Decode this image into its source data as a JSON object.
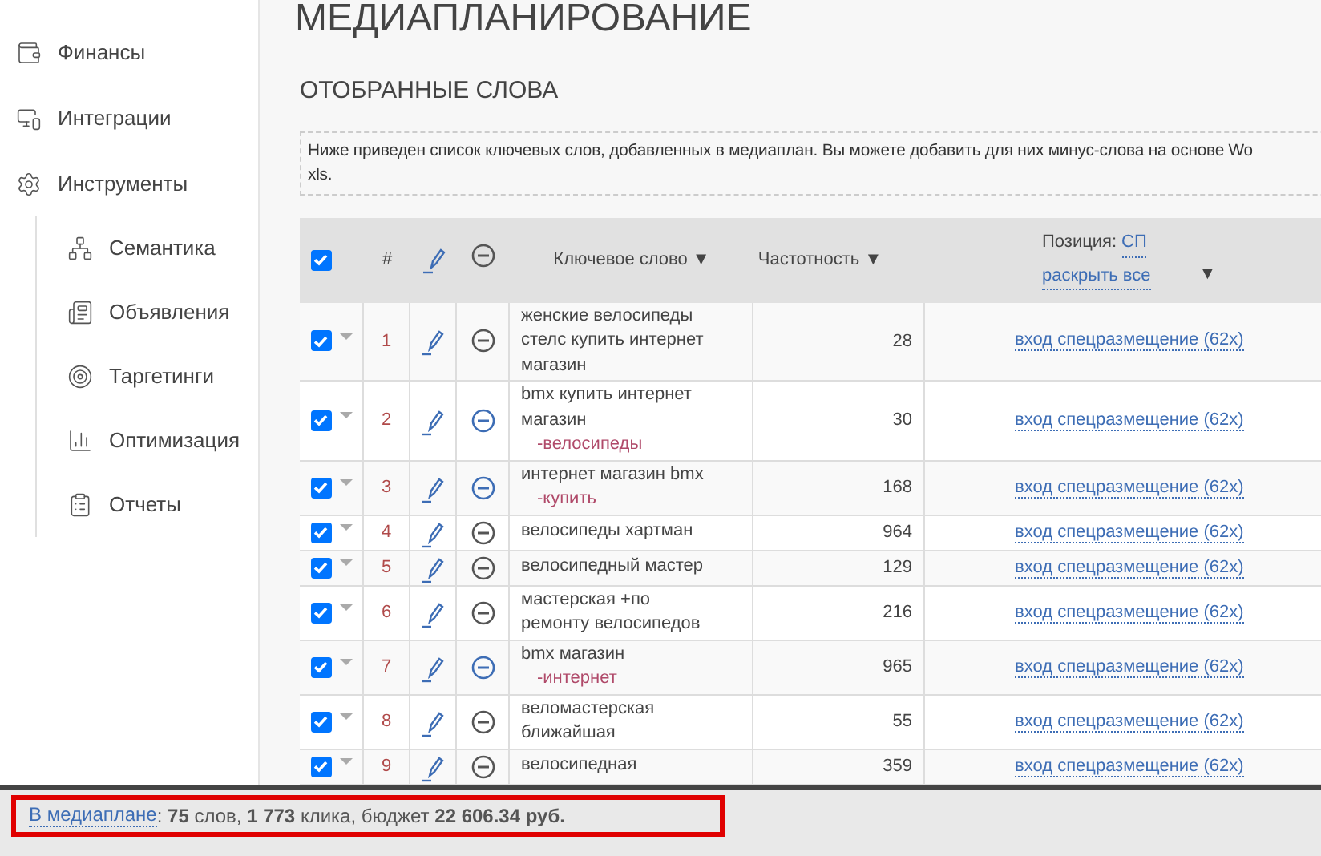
{
  "sidebar": {
    "items": [
      {
        "label": "Финансы"
      },
      {
        "label": "Интеграции"
      },
      {
        "label": "Инструменты",
        "children": [
          {
            "label": "Семантика"
          },
          {
            "label": "Объявления"
          },
          {
            "label": "Таргетинги"
          },
          {
            "label": "Оптимизация"
          },
          {
            "label": "Отчеты"
          }
        ]
      }
    ]
  },
  "page_title": "МЕДИАПЛАНИРОВАНИЕ",
  "section_title": "ОТОБРАННЫЕ СЛОВА",
  "info_lines": [
    "Ниже приведен список ключевых слов, добавленных в медиаплан. Вы можете добавить для них минус-слова на основе Wo",
    "xls."
  ],
  "table": {
    "header": {
      "checked": true,
      "number": "#",
      "keyword": "Ключевое слово ▼",
      "frequency": "Частотность ▼",
      "position_label": "Позиция:",
      "position_link": "СП",
      "expand_link": "раскрыть все",
      "sort_arrow": "▼"
    },
    "rows": [
      {
        "checked": true,
        "number": "1",
        "keyword": "женские велосипеды стелс купить интернет магазин",
        "minus_words": [],
        "minus_active": false,
        "frequency": "28",
        "position": "вход спецразмещение (62x)"
      },
      {
        "checked": true,
        "number": "2",
        "keyword": "bmx купить интернет магазин",
        "minus_words": [
          "-велосипеды"
        ],
        "minus_active": true,
        "frequency": "30",
        "position": "вход спецразмещение (62x)"
      },
      {
        "checked": true,
        "number": "3",
        "keyword": "интернет магазин bmx",
        "minus_words": [
          "-купить"
        ],
        "minus_active": true,
        "frequency": "168",
        "position": "вход спецразмещение (62x)"
      },
      {
        "checked": true,
        "number": "4",
        "keyword": "велосипеды хартман",
        "minus_words": [],
        "minus_active": false,
        "frequency": "964",
        "position": "вход спецразмещение (62x)"
      },
      {
        "checked": true,
        "number": "5",
        "keyword": "велосипедный мастер",
        "minus_words": [],
        "minus_active": false,
        "frequency": "129",
        "position": "вход спецразмещение (62x)"
      },
      {
        "checked": true,
        "number": "6",
        "keyword": "мастерская +по ремонту велосипедов",
        "minus_words": [],
        "minus_active": false,
        "frequency": "216",
        "position": "вход спецразмещение (62x)"
      },
      {
        "checked": true,
        "number": "7",
        "keyword": "bmx магазин",
        "minus_words": [
          "-интернет"
        ],
        "minus_active": true,
        "frequency": "965",
        "position": "вход спецразмещение (62x)"
      },
      {
        "checked": true,
        "number": "8",
        "keyword": "веломастерская ближайшая",
        "minus_words": [],
        "minus_active": false,
        "frequency": "55",
        "position": "вход спецразмещение (62x)"
      },
      {
        "checked": true,
        "number": "9",
        "keyword": "велосипедная",
        "minus_words": [],
        "minus_active": false,
        "frequency": "359",
        "position": "вход спецразмещение (62x)"
      }
    ]
  },
  "summary": {
    "link": "В медиаплане",
    "text": ": **75** слов, **1 773** клика, бюджет **22 606.34 руб.**"
  }
}
